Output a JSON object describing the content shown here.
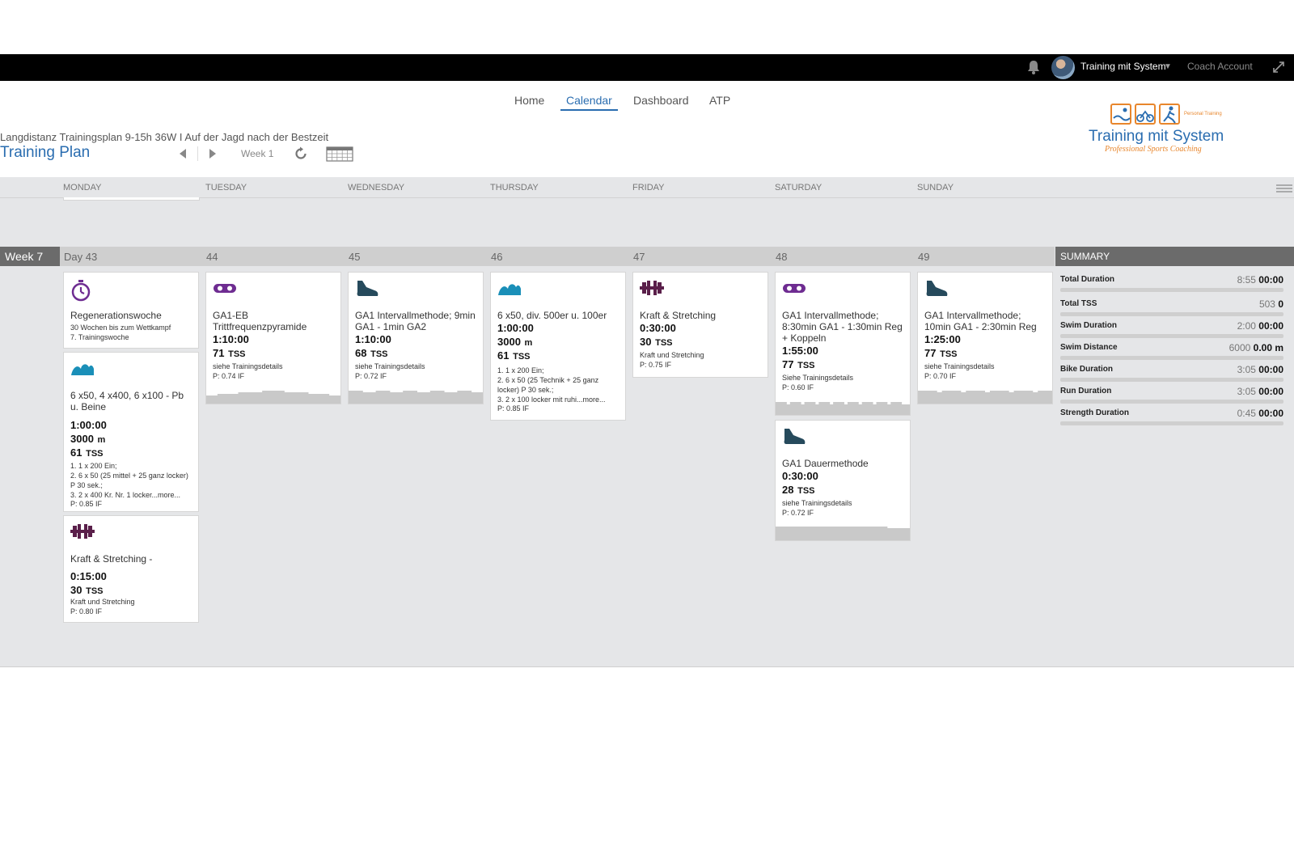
{
  "topbar": {
    "user_name": "Training mit System",
    "coach_account": "Coach Account",
    "icons": [
      "bell-icon",
      "avatar",
      "chevron-down-icon",
      "expand-icon"
    ]
  },
  "nav": {
    "items": [
      "Home",
      "Calendar",
      "Dashboard",
      "ATP"
    ],
    "active": "Calendar"
  },
  "plan": {
    "subtitle": "Langdistanz Trainingsplan 9-15h 36W I Auf der Jagd nach der Bestzeit",
    "title": "Training Plan",
    "week_selector": "Week 1"
  },
  "logo": {
    "text": "Training mit System",
    "tagline": "Professional Sports Coaching",
    "badge": "Personal Training"
  },
  "calendar": {
    "day_headers": [
      "MONDAY",
      "TUESDAY",
      "WEDNESDAY",
      "THURSDAY",
      "FRIDAY",
      "SATURDAY",
      "SUNDAY"
    ],
    "week_label": "Week 7",
    "day_numbers": [
      "Day 43",
      "44",
      "45",
      "46",
      "47",
      "48",
      "49"
    ]
  },
  "workouts": [
    {
      "day": 0,
      "icon": "stopwatch-icon",
      "color": "#6e2c91",
      "title": "Regenerationswoche",
      "desc": "30 Wochen bis zum Wettkampf\n7. Trainingswoche"
    },
    {
      "day": 0,
      "icon": "swim-wave-icon",
      "color": "#1a8fb8",
      "title": "6 x50, 4 x400, 6 x100 - Pb u. Beine",
      "duration": "1:00:00",
      "distance": "3000",
      "distance_unit": "m",
      "tss": "61",
      "tss_unit": "TSS",
      "desc": "1. 1 x 200 Ein;\n2. 6 x 50 (25 mittel + 25 ganz locker) P 30 sek.;\n3. 2 x 400 Kr. Nr. 1 locker...more...",
      "if": "P: 0.85 IF"
    },
    {
      "day": 0,
      "icon": "dumbbell-icon",
      "color": "#5a1f4a",
      "title": "Kraft & Stretching -",
      "duration": "0:15:00",
      "tss": "30",
      "tss_unit": "TSS",
      "desc": "Kraft und Stretching",
      "if": "P: 0.80 IF"
    },
    {
      "day": 1,
      "icon": "bike-chain-icon",
      "color": "#6e2c91",
      "title": "GA1-EB Trittfrequenzpyramide",
      "duration": "1:10:00",
      "tss": "71",
      "tss_unit": "TSS",
      "desc": "siehe Trainingsdetails",
      "if": "P: 0.74 IF"
    },
    {
      "day": 2,
      "icon": "run-shoe-icon",
      "color": "#264a5c",
      "title": "GA1 Intervallmethode; 9min GA1 - 1min GA2",
      "duration": "1:10:00",
      "tss": "68",
      "tss_unit": "TSS",
      "desc": "siehe Trainingsdetails",
      "if": "P: 0.72 IF"
    },
    {
      "day": 3,
      "icon": "swim-wave-icon",
      "color": "#1a8fb8",
      "title": "6 x50, div. 500er u. 100er",
      "duration": "1:00:00",
      "distance": "3000",
      "distance_unit": "m",
      "tss": "61",
      "tss_unit": "TSS",
      "desc": "1. 1 x 200 Ein;\n2. 6 x 50 (25 Technik + 25 ganz locker) P 30 sek.;\n3. 2 x 100 locker mit ruhi...more...",
      "if": "P: 0.85 IF"
    },
    {
      "day": 4,
      "icon": "dumbbell-icon",
      "color": "#5a1f4a",
      "title": "Kraft & Stretching",
      "duration": "0:30:00",
      "tss": "30",
      "tss_unit": "TSS",
      "desc": "Kraft und Stretching",
      "if": "P: 0.75 IF"
    },
    {
      "day": 5,
      "icon": "bike-chain-icon",
      "color": "#6e2c91",
      "title": "GA1 Intervallmethode; 8:30min GA1 - 1:30min Reg + Koppeln",
      "duration": "1:55:00",
      "tss": "77",
      "tss_unit": "TSS",
      "desc": "Siehe Trainingsdetails",
      "if": "P: 0.60 IF"
    },
    {
      "day": 5,
      "icon": "run-shoe-icon",
      "color": "#264a5c",
      "title": "GA1 Dauermethode",
      "duration": "0:30:00",
      "tss": "28",
      "tss_unit": "TSS",
      "desc": "siehe Trainingsdetails",
      "if": "P: 0.72 IF"
    },
    {
      "day": 6,
      "icon": "run-shoe-icon",
      "color": "#264a5c",
      "title": "GA1 Intervallmethode; 10min GA1 - 2:30min Reg",
      "duration": "1:25:00",
      "tss": "77",
      "tss_unit": "TSS",
      "desc": "siehe Trainingsdetails",
      "if": "P: 0.70 IF"
    }
  ],
  "summary": {
    "header": "SUMMARY",
    "rows": [
      {
        "label": "Total Duration",
        "planned": "8:55",
        "actual": "00:00"
      },
      {
        "label": "Total TSS",
        "planned": "503",
        "actual": "0"
      },
      {
        "label": "Swim Duration",
        "planned": "2:00",
        "actual": "00:00"
      },
      {
        "label": "Swim Distance",
        "planned": "6000",
        "actual": "0.00 m"
      },
      {
        "label": "Bike Duration",
        "planned": "3:05",
        "actual": "00:00"
      },
      {
        "label": "Run Duration",
        "planned": "3:05",
        "actual": "00:00"
      },
      {
        "label": "Strength Duration",
        "planned": "0:45",
        "actual": "00:00"
      }
    ]
  }
}
